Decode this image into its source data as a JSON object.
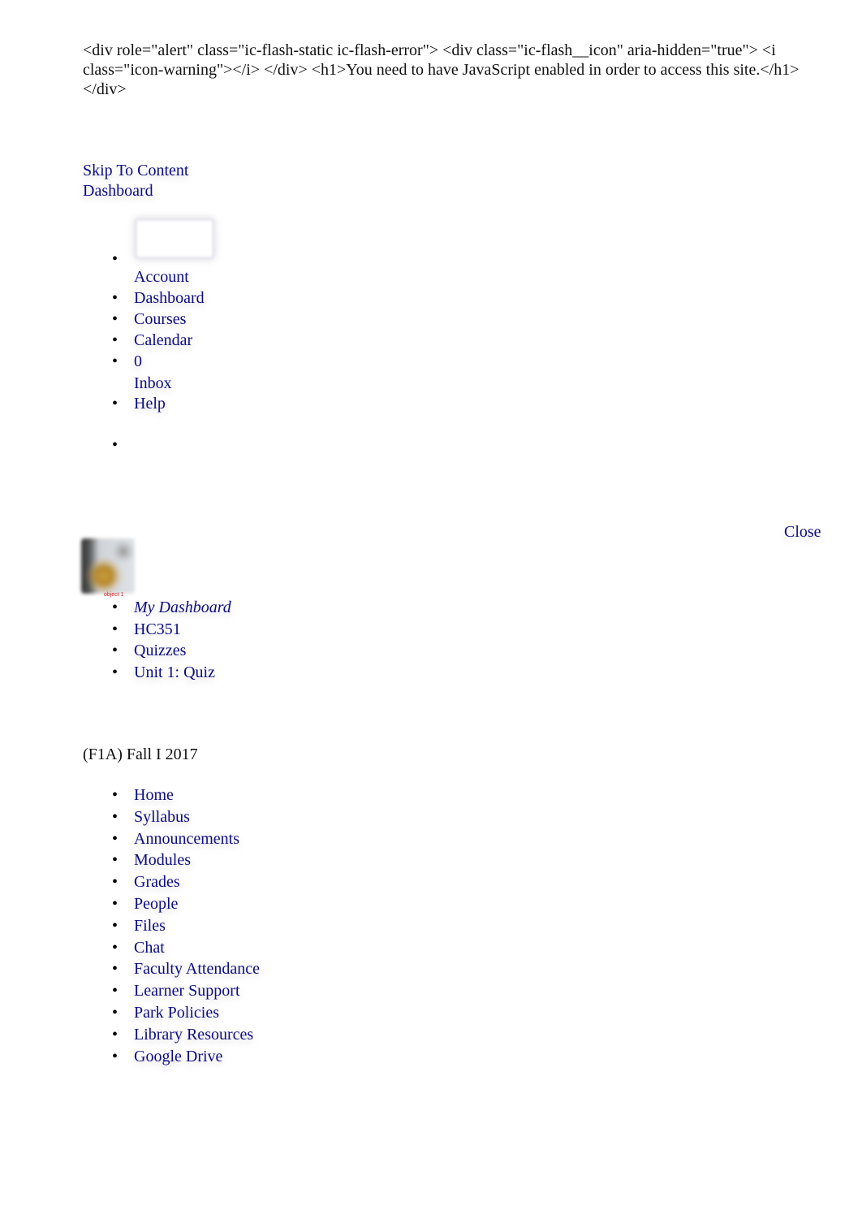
{
  "noscript_message": "<div role=\"alert\" class=\"ic-flash-static ic-flash-error\"> <div class=\"ic-flash__icon\" aria-hidden=\"true\"> <i class=\"icon-warning\"></i> </div> <h1>You need to have JavaScript enabled in order to access this site.</h1> </div>",
  "header": {
    "skip_link": "Skip To Content",
    "dashboard_link": "Dashboard"
  },
  "global_nav": {
    "items": [
      {
        "label": "Account",
        "icon": "avatar-icon"
      },
      {
        "label": "Dashboard"
      },
      {
        "label": "Courses"
      },
      {
        "label": "Calendar"
      },
      {
        "badge": "0",
        "label": "Inbox"
      },
      {
        "label": "Help"
      },
      {
        "label": ""
      }
    ]
  },
  "close_label": "Close",
  "course_image": {
    "label": "object 1"
  },
  "breadcrumbs": [
    {
      "label": "My Dashboard"
    },
    {
      "label": "HC351"
    },
    {
      "label": "Quizzes"
    },
    {
      "label": "Unit 1: Quiz"
    }
  ],
  "term": "(F1A) Fall I 2017",
  "course_nav": [
    {
      "label": "Home"
    },
    {
      "label": "Syllabus"
    },
    {
      "label": "Announcements"
    },
    {
      "label": "Modules"
    },
    {
      "label": "Grades"
    },
    {
      "label": "People"
    },
    {
      "label": "Files"
    },
    {
      "label": "Chat"
    },
    {
      "label": "Faculty Attendance"
    },
    {
      "label": "Learner Support"
    },
    {
      "label": "Park Policies"
    },
    {
      "label": "Library Resources"
    },
    {
      "label": "Google Drive"
    }
  ],
  "colors": {
    "link": "#0d0d80",
    "text": "#111111",
    "image_label": "#dd2222"
  }
}
